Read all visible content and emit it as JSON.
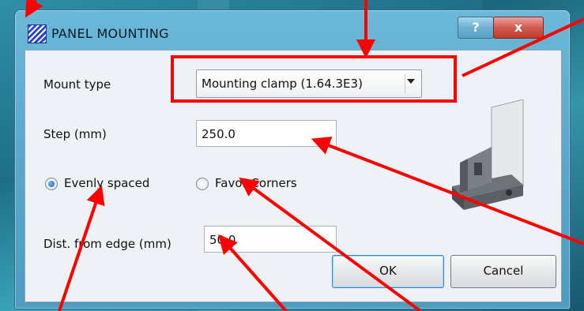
{
  "window": {
    "title": "PANEL MOUNTING",
    "help_label": "?",
    "close_label": "x"
  },
  "form": {
    "mount_type_label": "Mount type",
    "mount_type_value": "Mounting clamp (1.64.3E3)",
    "step_label": "Step (mm)",
    "step_value": "250.0",
    "evenly_spaced_label": "Evenly spaced",
    "favor_corners_label": "Favor Corners",
    "dist_label": "Dist. from edge (mm)",
    "dist_value": "50.0",
    "selected_spacing": "Evenly spaced"
  },
  "buttons": {
    "ok_label": "OK",
    "cancel_label": "Cancel"
  },
  "colors": {
    "annotation": "#ff0000",
    "window_frame": "#5aa7cb",
    "client_bg": "#eef1f5"
  },
  "icons": {
    "app": "striped-blue-icon",
    "preview": "mounting-clamp-3d-icon"
  }
}
